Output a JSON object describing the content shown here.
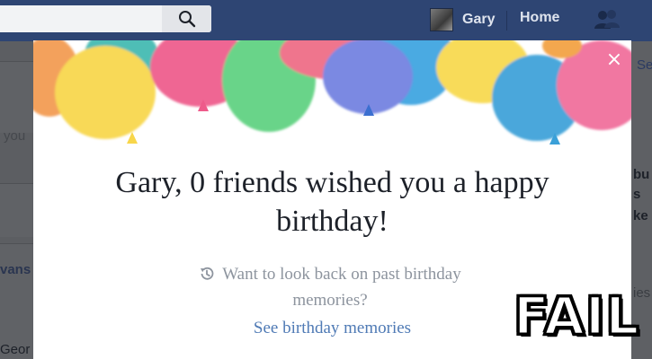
{
  "nav": {
    "search_icon": "search-icon",
    "profile_name": "Gary",
    "home_label": "Home",
    "friends_icon": "friend-requests-icon"
  },
  "background": {
    "left_fragments": [
      "you",
      "vans",
      "Geor"
    ],
    "right_fragments": [
      "Se",
      "bu",
      "s",
      "ke",
      "ies"
    ]
  },
  "modal": {
    "close_label": "×",
    "headline": "Gary, 0 friends wished you a happy birthday!",
    "prompt": "Want to look back on past birthday memories?",
    "prompt_icon": "history-clock-icon",
    "link": "See birthday memories"
  },
  "overlay": {
    "stamp": "FAIL"
  },
  "colors": {
    "navbar": "#2e4573",
    "link": "#4f7ab5",
    "prompt_text": "#8d949e",
    "headline_text": "#1d2129"
  }
}
